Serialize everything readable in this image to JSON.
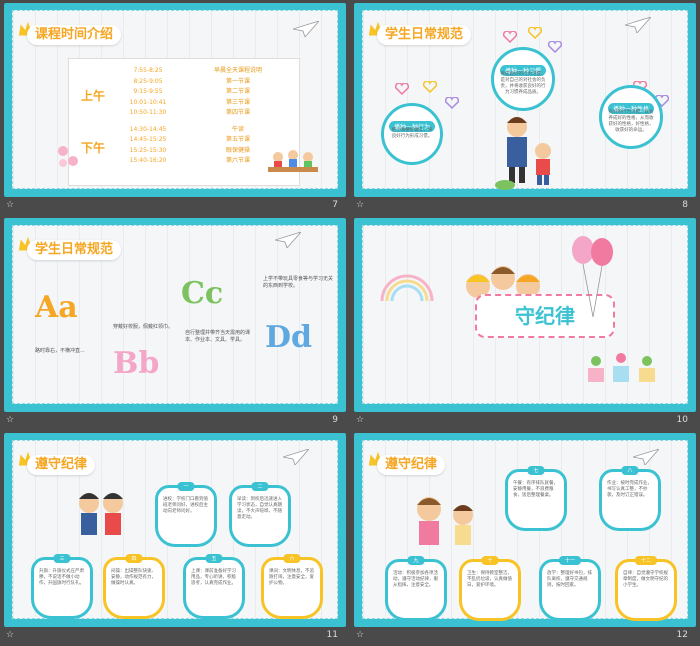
{
  "slides": [
    {
      "page": "7",
      "title": "课程时间介绍",
      "am_label": "上午",
      "pm_label": "下午",
      "rows": [
        [
          "7:55-8:25",
          "早晨全天课程说明"
        ],
        [
          "8:25-9:05",
          "第一节课"
        ],
        [
          "9:15-9:55",
          "第二节课"
        ],
        [
          "10:01-10:41",
          "第三节课"
        ],
        [
          "10:50-11:30",
          "第四节课"
        ],
        [
          "14:30-14:45",
          "午读"
        ],
        [
          "14:45-15:25",
          "第五节课"
        ],
        [
          "15:25-15:30",
          "眼保健操"
        ],
        [
          "15:40-16:20",
          "第六节课"
        ]
      ]
    },
    {
      "page": "8",
      "title": "学生日常规范",
      "c1_label": "播种一种习惯",
      "c1_text": "养成良好的行为习惯，是对自己的对社会的负责，并将收获良好的行为习惯养成品质。",
      "c2_label": "播种一种行为",
      "c2_text": "把小事做好做实，将良好行为形成习惯。",
      "c3_label": "播种一种性格",
      "c3_text": "有好的行为习惯，就会养成好的性格，从而收获好的性格，好性格，收获好的命运。"
    },
    {
      "page": "9",
      "title": "学生日常规范",
      "t1": "路时靠右，不横冲直...",
      "t2": "穿戴好校服，佩戴红领巾。",
      "t3": "自行整理并带齐当天需用的课本、作业本、文具、学具。",
      "t4": "上学不带玩具零食等与学习无关的东西到学校。"
    },
    {
      "page": "10",
      "title": "守纪律"
    },
    {
      "page": "11",
      "title": "遵守纪律",
      "shields": [
        {
          "num": "一",
          "text": "进校：学校门口看到值班老师问好，进校后主动向老师问好。"
        },
        {
          "num": "二",
          "text": "早读：到校后迅速进入学习状态，自觉认真朗读，不大声喧哗，不随意走动。"
        },
        {
          "num": "三",
          "text": "升旗：升旗仪式庄严肃穆，不说话不做小动作，升国旗时行队礼。"
        },
        {
          "num": "四",
          "text": "间操：出操整队快速、安静，动作规范有力，做操时认真。"
        },
        {
          "num": "五",
          "text": "上课：课前准备好学习用品，专心听讲，积极思考，认真完成作业。"
        },
        {
          "num": "六",
          "text": "课间：文明休息，不追跑打闹，注意安全，爱护公物。"
        }
      ]
    },
    {
      "page": "12",
      "title": "遵守纪律",
      "shields": [
        {
          "num": "七",
          "text": "午餐：有序排队就餐，安静用餐，不浪费粮食，饭后整理餐桌。"
        },
        {
          "num": "八",
          "text": "作业：按时完成作业，书写认真工整，不抄袭，及时订正错误。"
        },
        {
          "num": "九",
          "text": "活动：积极参加各项活动，遵守活动纪律，服从指挥，注意安全。"
        },
        {
          "num": "十",
          "text": "卫生：保持教室整洁，不乱扔垃圾，认真做值日，爱护环境。"
        },
        {
          "num": "十一",
          "text": "放学：整理好书包，排队离校，遵守交通规则，按时回家。"
        },
        {
          "num": "十二",
          "text": "自律：自觉遵守学校规章制度，做文明守纪的小学生。"
        }
      ]
    }
  ],
  "footer_icon": "star-icon",
  "colors": {
    "frame": "#3bc2d2",
    "title": "#f5a623",
    "yellow": "#f7c325"
  }
}
